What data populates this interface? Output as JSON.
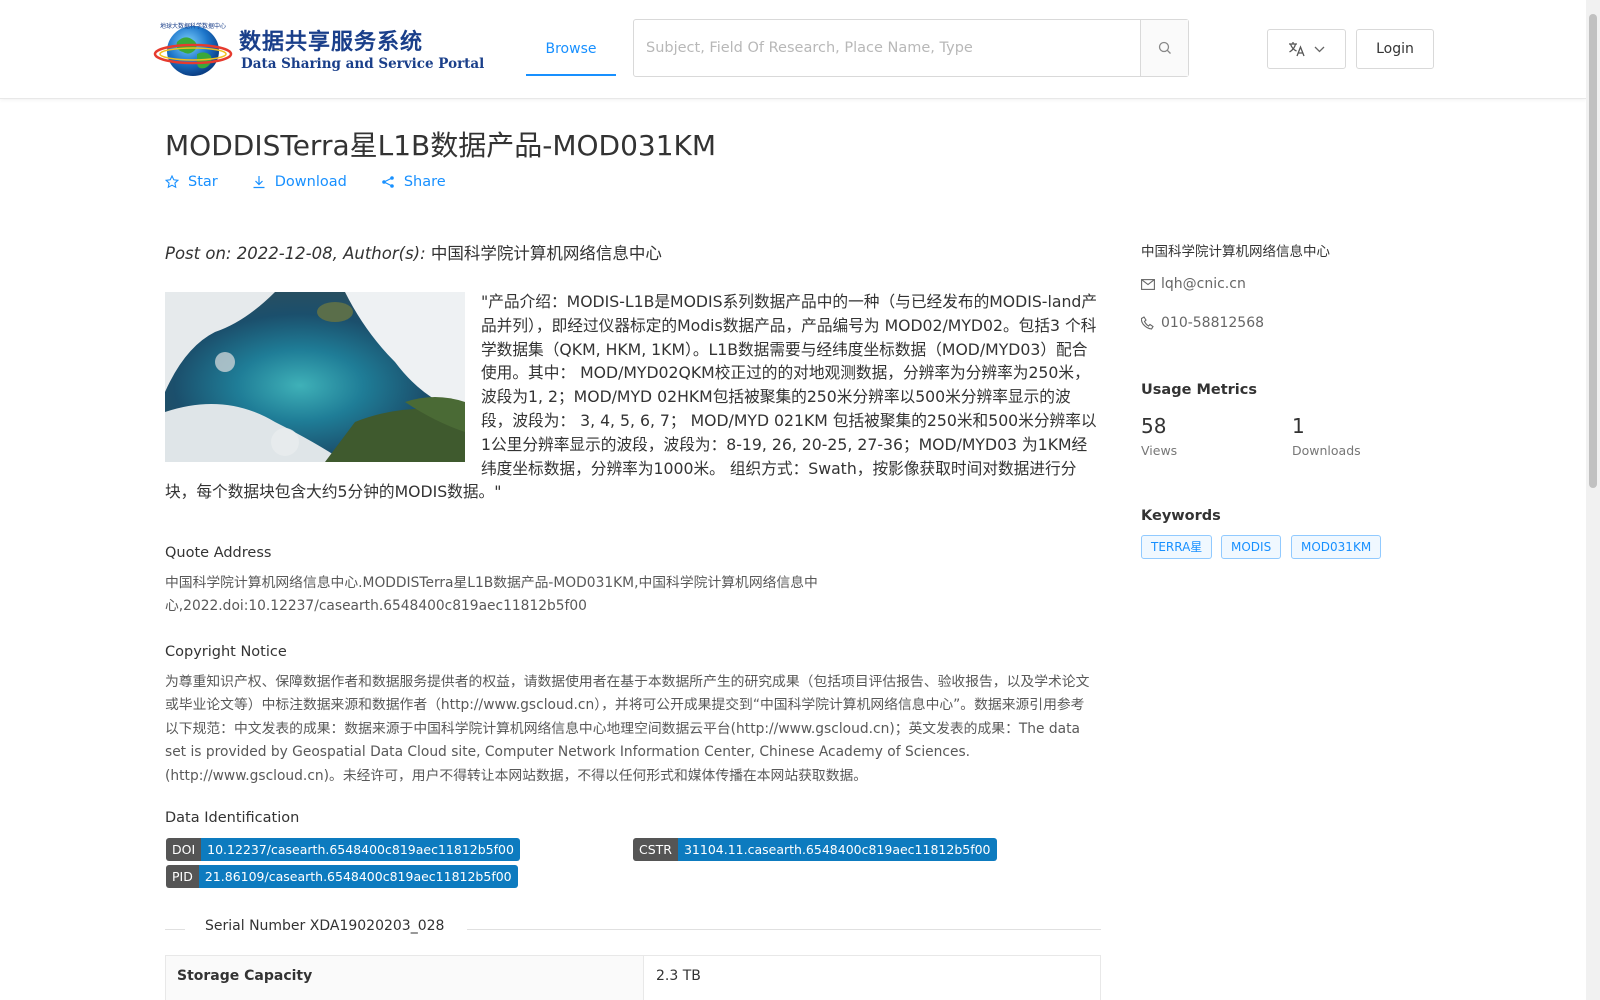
{
  "header": {
    "logo_cn": "数据共享服务系统",
    "logo_en": "Data Sharing and Service Portal",
    "logo_ring_text": "地球大数据科学数据中心",
    "nav_browse": "Browse",
    "search_placeholder": "Subject, Field Of Research, Place Name, Type",
    "login_label": "Login",
    "language_icon": "translate-icon"
  },
  "dataset": {
    "title": "MODDISTerra星L1B数据产品-MOD031KM",
    "actions": {
      "star": "Star",
      "download": "Download",
      "share": "Share"
    },
    "meta_prefix": "Post on: 2022-12-08, Author(s): ",
    "author": "中国科学院计算机网络信息中心",
    "description": "\"产品介绍：MODIS-L1B是MODIS系列数据产品中的一种（与已经发布的MODIS-land产品并列），即经过仪器标定的Modis数据产品，产品编号为 MOD02/MYD02。包括3 个科学数据集（QKM, HKM, 1KM）。L1B数据需要与经纬度坐标数据（MOD/MYD03）配合使用。其中： MOD/MYD02QKM校正过的的对地观测数据，分辨率为分辨率为250米，波段为1, 2；MOD/MYD 02HKM包括被聚集的250米分辨率以500米分辨率显示的波段，波段为： 3, 4, 5, 6, 7； MOD/MYD 021KM 包括被聚集的250米和500米分辨率以1公里分辨率显示的波段，波段为：8-19, 26, 20-25, 27-36；MOD/MYD03 为1KM经纬度坐标数据，分辨率为1000米。 组织方式：Swath，按影像获取时间对数据进行分块，每个数据块包含大约5分钟的MODIS数据。\"",
    "quote_title": "Quote Address",
    "quote_text": "中国科学院计算机网络信息中心.MODDISTerra星L1B数据产品-MOD031KM,中国科学院计算机网络信息中心,2022.doi:10.12237/casearth.6548400c819aec11812b5f00",
    "copyright_title": "Copyright Notice",
    "copyright_text": "为尊重知识产权、保障数据作者和数据服务提供者的权益，请数据使用者在基于本数据所产生的研究成果（包括项目评估报告、验收报告，以及学术论文或毕业论文等）中标注数据来源和数据作者（http://www.gscloud.cn），并将可公开成果提交到“中国科学院计算机网络信息中心”。数据来源引用参考以下规范：中文发表的成果：数据来源于中国科学院计算机网络信息中心地理空间数据云平台(http://www.gscloud.cn)；英文发表的成果：The data set is provided by Geospatial Data Cloud site, Computer Network Information Center, Chinese Academy of Sciences.(http://www.gscloud.cn)。未经许可，用户不得转让本网站数据，不得以任何形式和媒体传播在本网站获取数据。",
    "identification_title": "Data Identification",
    "identifiers": {
      "doi": {
        "key": "DOI",
        "value": "10.12237/casearth.6548400c819aec11812b5f00"
      },
      "cstr": {
        "key": "CSTR",
        "value": "31104.11.casearth.6548400c819aec11812b5f00"
      },
      "pid": {
        "key": "PID",
        "value": "21.86109/casearth.6548400c819aec11812b5f00"
      }
    },
    "serial": "Serial Number XDA19020203_028",
    "table": {
      "storage_label": "Storage Capacity",
      "storage_value": "2.3 TB"
    }
  },
  "sidebar": {
    "org": "中国科学院计算机网络信息中心",
    "email": "lqh@cnic.cn",
    "phone": "010-58812568",
    "usage_title": "Usage Metrics",
    "views_count": "58",
    "views_label": "Views",
    "downloads_count": "1",
    "downloads_label": "Downloads",
    "keywords_title": "Keywords",
    "keywords": [
      "TERRA星",
      "MODIS",
      "MOD031KM"
    ]
  },
  "colors": {
    "accent": "#1890ff",
    "tag_value": "#0d7bbf",
    "tag_key": "#555555"
  }
}
